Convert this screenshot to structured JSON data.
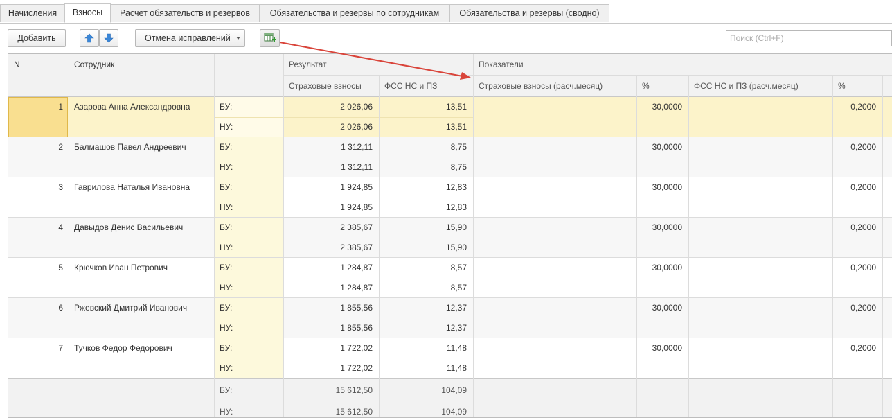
{
  "tabs": [
    {
      "label": "Начисления",
      "active": false
    },
    {
      "label": "Взносы",
      "active": true
    },
    {
      "label": "Расчет обязательств и резервов",
      "active": false
    },
    {
      "label": "Обязательства и резервы по сотрудникам",
      "active": false
    },
    {
      "label": "Обязательства и резервы (сводно)",
      "active": false
    }
  ],
  "toolbar": {
    "add_label": "Добавить",
    "cancel_corrections_label": "Отмена исправлений",
    "search_placeholder": "Поиск (Ctrl+F)"
  },
  "table": {
    "headers": {
      "n": "N",
      "employee": "Сотрудник",
      "result_group": "Результат",
      "indicators_group": "Показатели",
      "insurance": "Страховые взносы",
      "fss": "ФСС НС и ПЗ",
      "insurance_month": "Страховые взносы (расч.месяц)",
      "pct1": "%",
      "fss_month": "ФСС НС и ПЗ (расч.месяц)",
      "pct2": "%"
    },
    "bu_label": "БУ:",
    "nu_label": "НУ:",
    "rows": [
      {
        "n": "1",
        "name": "Азарова Анна Александровна",
        "bu_ins": "2 026,06",
        "bu_fss": "13,51",
        "nu_ins": "2 026,06",
        "nu_fss": "13,51",
        "pct1": "30,0000",
        "pct2": "0,2000",
        "selected": true
      },
      {
        "n": "2",
        "name": "Балмашов Павел Андреевич",
        "bu_ins": "1 312,11",
        "bu_fss": "8,75",
        "nu_ins": "1 312,11",
        "nu_fss": "8,75",
        "pct1": "30,0000",
        "pct2": "0,2000",
        "selected": false
      },
      {
        "n": "3",
        "name": "Гаврилова Наталья Ивановна",
        "bu_ins": "1 924,85",
        "bu_fss": "12,83",
        "nu_ins": "1 924,85",
        "nu_fss": "12,83",
        "pct1": "30,0000",
        "pct2": "0,2000",
        "selected": false
      },
      {
        "n": "4",
        "name": "Давыдов Денис Васильевич",
        "bu_ins": "2 385,67",
        "bu_fss": "15,90",
        "nu_ins": "2 385,67",
        "nu_fss": "15,90",
        "pct1": "30,0000",
        "pct2": "0,2000",
        "selected": false
      },
      {
        "n": "5",
        "name": "Крючков Иван Петрович",
        "bu_ins": "1 284,87",
        "bu_fss": "8,57",
        "nu_ins": "1 284,87",
        "nu_fss": "8,57",
        "pct1": "30,0000",
        "pct2": "0,2000",
        "selected": false
      },
      {
        "n": "6",
        "name": "Ржевский Дмитрий Иванович",
        "bu_ins": "1 855,56",
        "bu_fss": "12,37",
        "nu_ins": "1 855,56",
        "nu_fss": "12,37",
        "pct1": "30,0000",
        "pct2": "0,2000",
        "selected": false
      },
      {
        "n": "7",
        "name": "Тучков Федор Федорович",
        "bu_ins": "1 722,02",
        "bu_fss": "11,48",
        "nu_ins": "1 722,02",
        "nu_fss": "11,48",
        "pct1": "30,0000",
        "pct2": "0,2000",
        "selected": false
      }
    ],
    "totals": {
      "bu_ins": "15 612,50",
      "bu_fss": "104,09",
      "nu_ins": "15 612,50",
      "nu_fss": "104,09"
    }
  },
  "colors": {
    "selected_row": "#fcf3ca",
    "selected_cell": "#f9df90",
    "bu_nu_column": "#fdf9dc",
    "alt_row": "#f7f7f7",
    "arrow": "#d9443a",
    "arrow_icon": "#3a87d8"
  },
  "icons": [
    "arrow-up-icon",
    "arrow-down-icon",
    "dropdown-caret-icon",
    "table-settings-icon"
  ]
}
